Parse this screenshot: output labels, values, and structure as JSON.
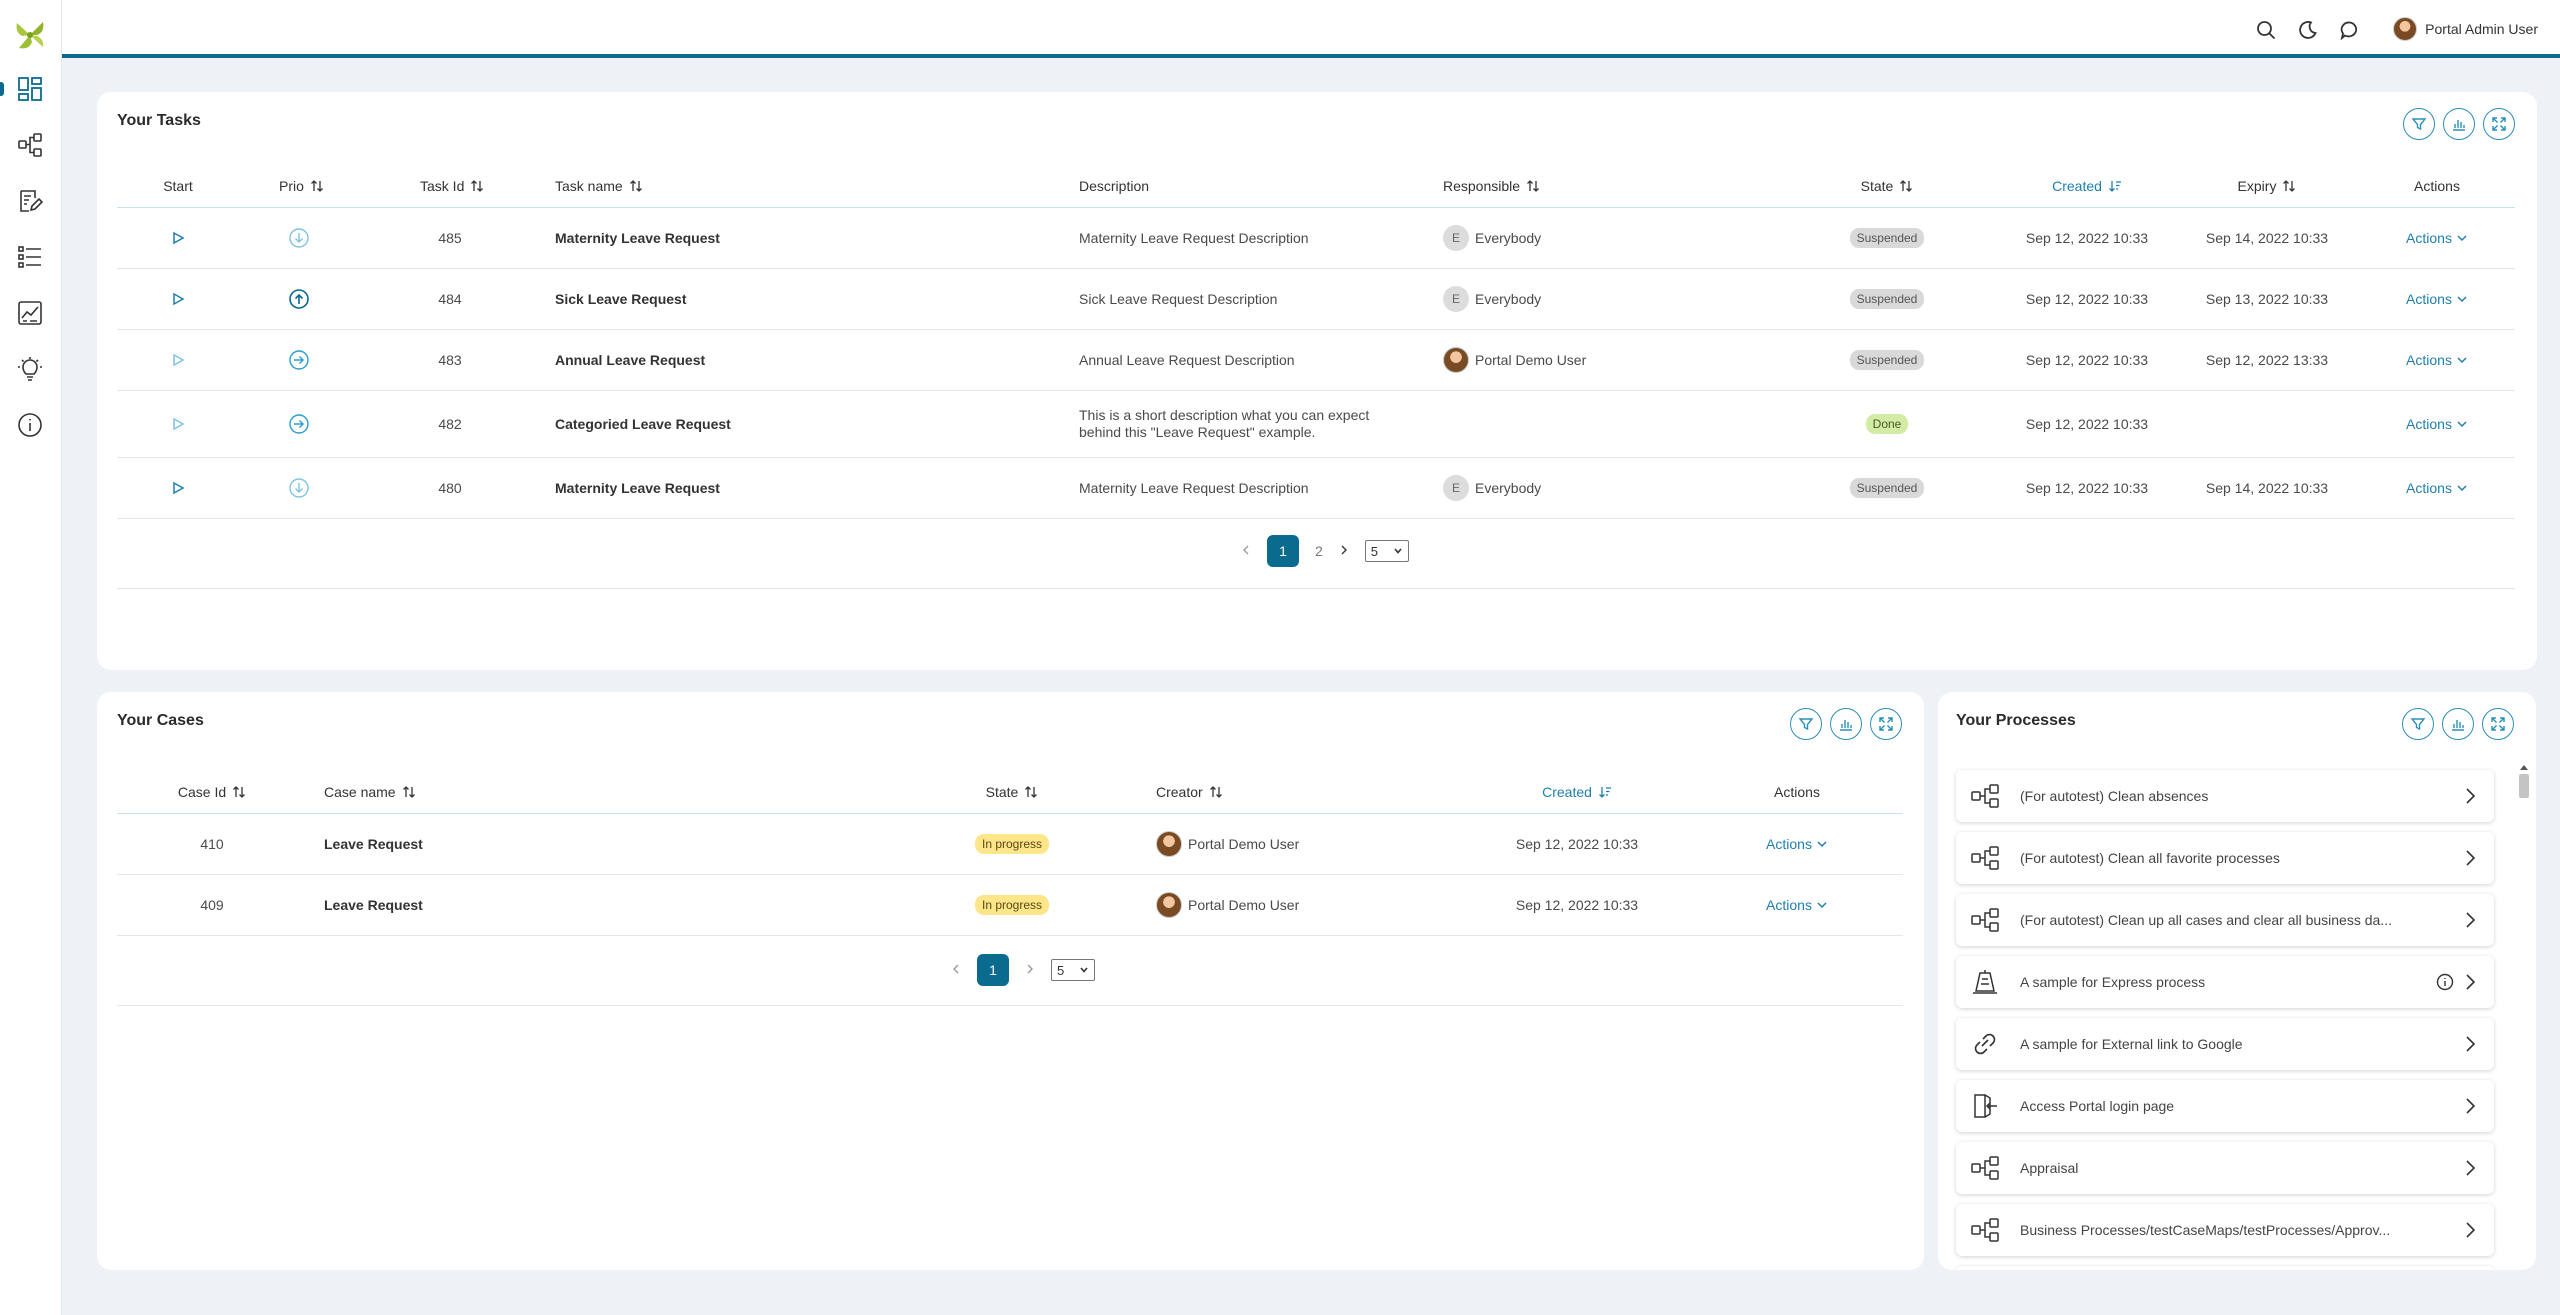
{
  "app": {
    "user_name": "Portal Admin User",
    "accent_color": "#0b6b8f",
    "sidebar_icons": [
      "dashboard-icon",
      "process-icon",
      "task-edit-icon",
      "case-list-icon",
      "statistics-icon",
      "idea-icon",
      "info-icon"
    ],
    "topbar_icons": [
      "search-icon",
      "dark-mode-icon",
      "chat-icon"
    ]
  },
  "tasks": {
    "title": "Your Tasks",
    "headers": {
      "start": "Start",
      "prio": "Prio",
      "task_id": "Task Id",
      "task_name": "Task name",
      "description": "Description",
      "responsible": "Responsible",
      "state": "State",
      "created": "Created",
      "expiry": "Expiry",
      "actions": "Actions"
    },
    "rows": [
      {
        "prio": "low",
        "id": "485",
        "name": "Maternity Leave Request",
        "description": "Maternity Leave Request Description",
        "resp_initial": "E",
        "responsible": "Everybody",
        "state": "Suspended",
        "created": "Sep 12, 2022 10:33",
        "expiry": "Sep 14, 2022 10:33",
        "actions": "Actions"
      },
      {
        "prio": "high",
        "id": "484",
        "name": "Sick Leave Request",
        "description": "Sick Leave Request Description",
        "resp_initial": "E",
        "responsible": "Everybody",
        "state": "Suspended",
        "created": "Sep 12, 2022 10:33",
        "expiry": "Sep 13, 2022 10:33",
        "actions": "Actions"
      },
      {
        "prio": "normal",
        "id": "483",
        "name": "Annual Leave Request",
        "description": "Annual Leave Request Description",
        "resp_initial": "",
        "responsible": "Portal Demo User",
        "state": "Suspended",
        "created": "Sep 12, 2022 10:33",
        "expiry": "Sep 12, 2022 13:33",
        "actions": "Actions"
      },
      {
        "prio": "normal",
        "id": "482",
        "name": "Categoried Leave Request",
        "description_line1": "This is a short description what you can expect",
        "description_line2": "behind this \"Leave Request\" example.",
        "responsible": "",
        "state": "Done",
        "created": "Sep 12, 2022 10:33",
        "expiry": "",
        "actions": "Actions"
      },
      {
        "prio": "low",
        "id": "480",
        "name": "Maternity Leave Request",
        "description": "Maternity Leave Request Description",
        "resp_initial": "E",
        "responsible": "Everybody",
        "state": "Suspended",
        "created": "Sep 12, 2022 10:33",
        "expiry": "Sep 14, 2022 10:33",
        "actions": "Actions"
      }
    ],
    "pager": {
      "current": "1",
      "next_page": "2",
      "page_size": "5"
    }
  },
  "cases": {
    "title": "Your Cases",
    "headers": {
      "case_id": "Case Id",
      "case_name": "Case name",
      "state": "State",
      "creator": "Creator",
      "created": "Created",
      "actions": "Actions"
    },
    "rows": [
      {
        "id": "410",
        "name": "Leave Request",
        "state": "In progress",
        "creator": "Portal Demo User",
        "created": "Sep 12, 2022 10:33",
        "actions": "Actions"
      },
      {
        "id": "409",
        "name": "Leave Request",
        "state": "In progress",
        "creator": "Portal Demo User",
        "created": "Sep 12, 2022 10:33",
        "actions": "Actions"
      }
    ],
    "pager": {
      "current": "1",
      "page_size": "5"
    }
  },
  "processes": {
    "title": "Your Processes",
    "items": [
      {
        "label": "(For autotest) Clean absences",
        "icon": "process-icon"
      },
      {
        "label": "(For autotest) Clean all favorite processes",
        "icon": "process-icon"
      },
      {
        "label": "(For autotest) Clean up all cases and clear all business da...",
        "icon": "process-icon"
      },
      {
        "label": "A sample for Express process",
        "icon": "express-icon"
      },
      {
        "label": "A sample for External link to Google",
        "icon": "link-icon"
      },
      {
        "label": "Access Portal login page",
        "icon": "login-icon"
      },
      {
        "label": "Appraisal",
        "icon": "process-icon"
      },
      {
        "label": "Business Processes/testCaseMaps/testProcesses/Approv...",
        "icon": "process-icon"
      }
    ]
  }
}
